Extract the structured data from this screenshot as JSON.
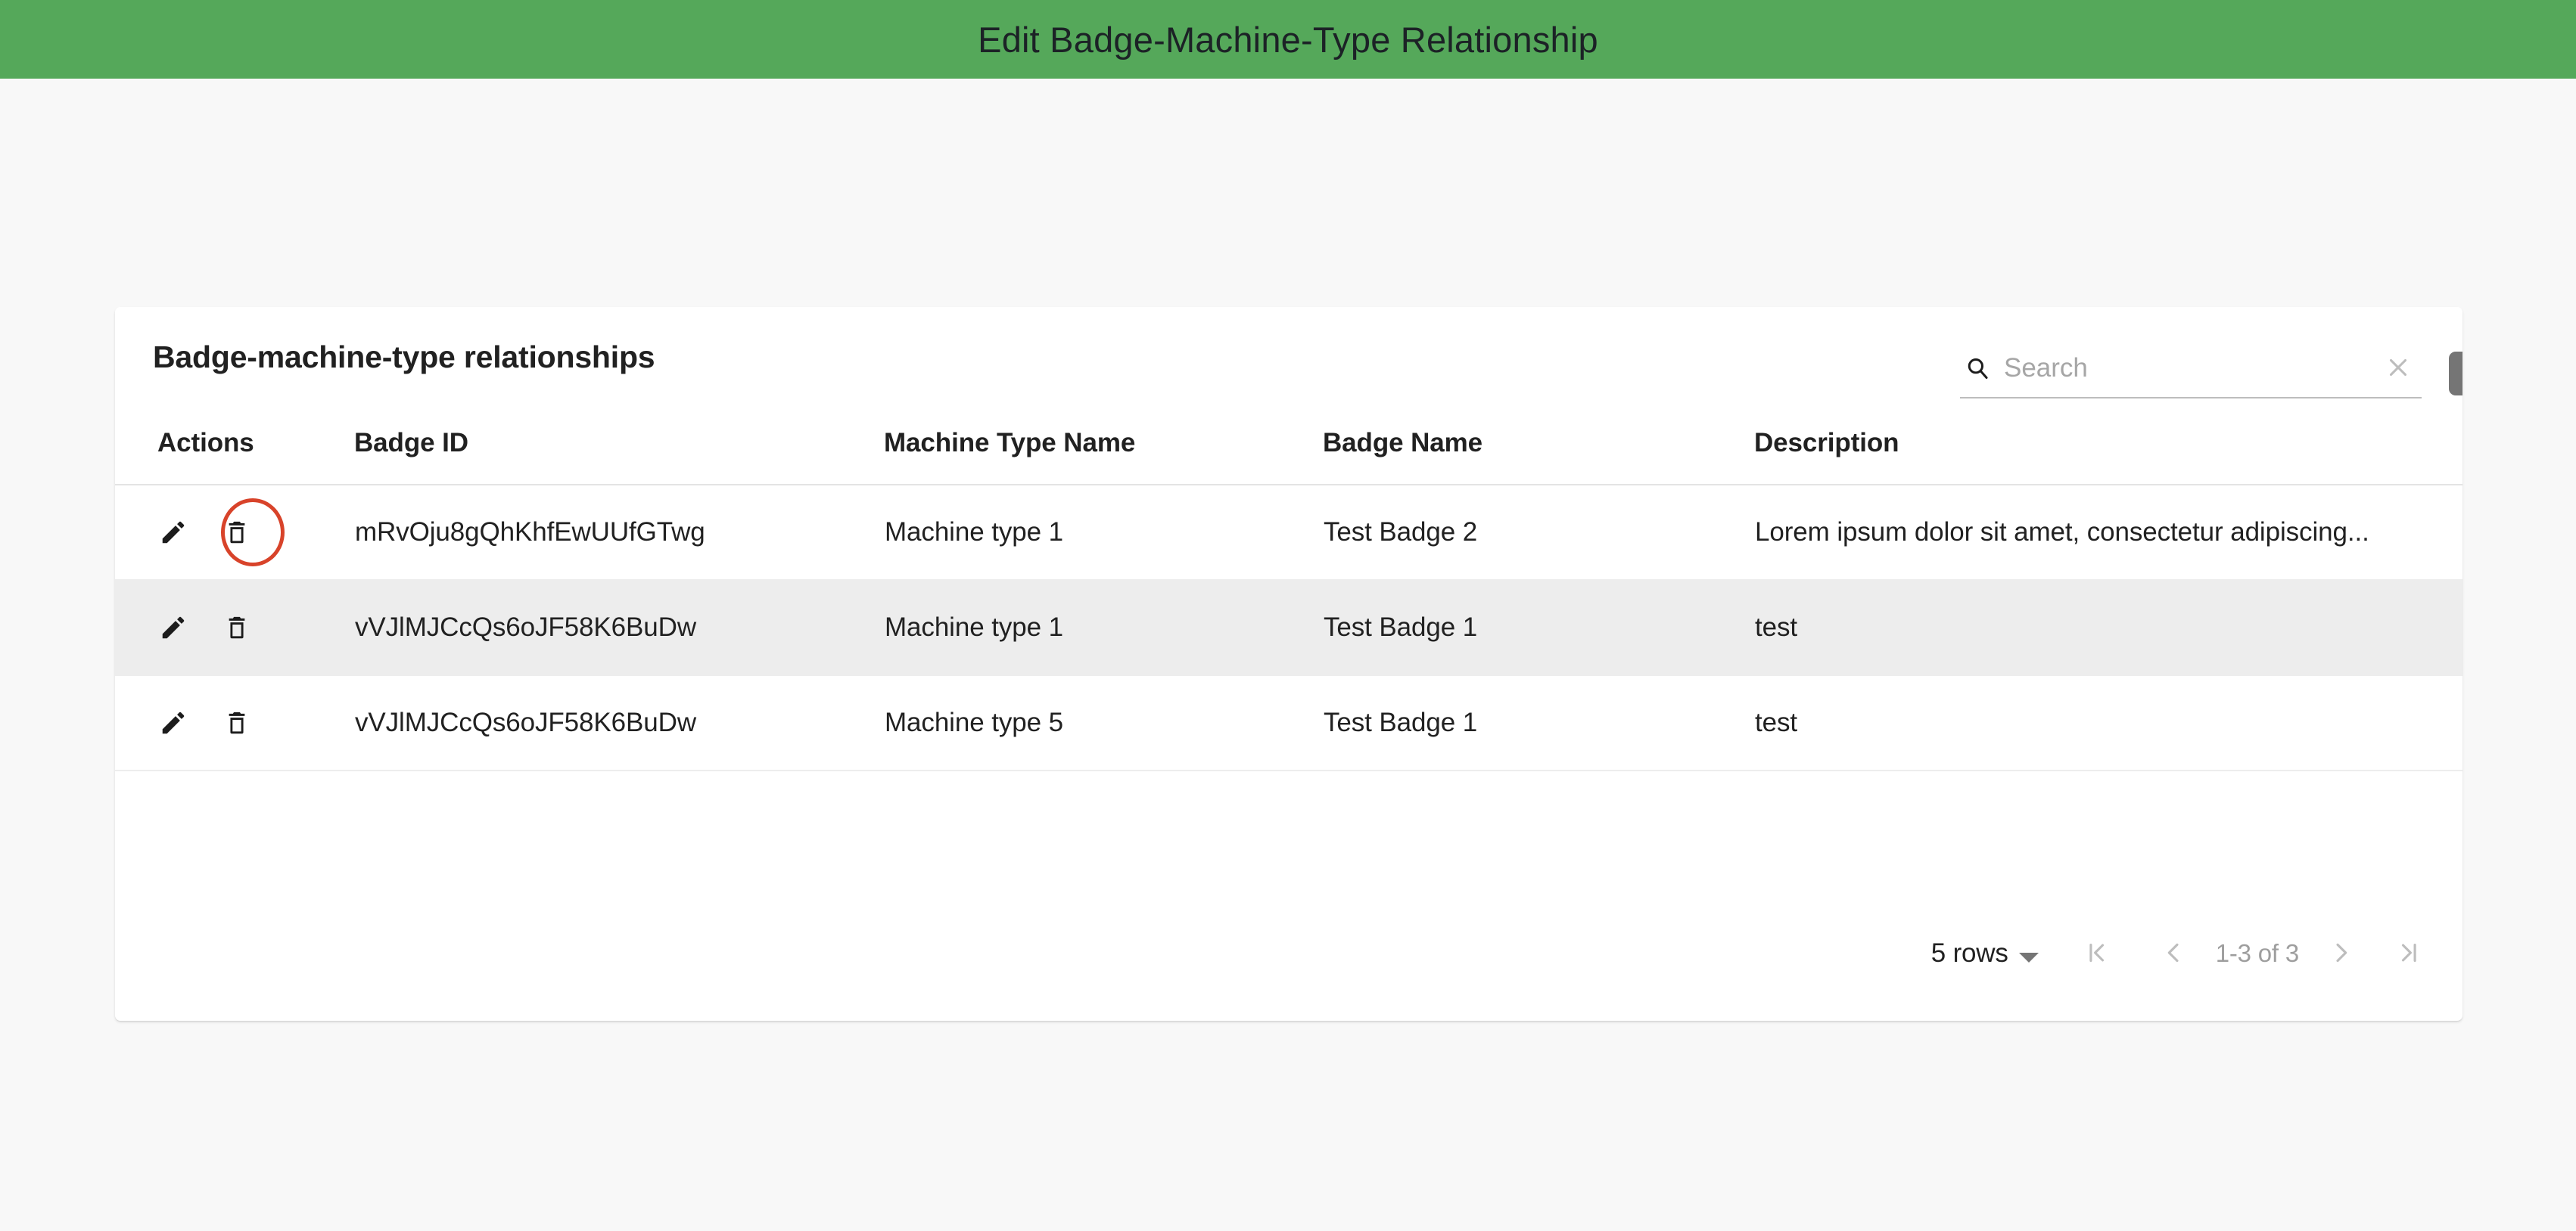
{
  "header": {
    "title": "Edit Badge-Machine-Type Relationship",
    "background_color": "#55a85a",
    "text_color": "#1c2226"
  },
  "card": {
    "title": "Badge-machine-type relationships",
    "search": {
      "value": "",
      "placeholder": "Search",
      "icon": "search-icon",
      "clear_icon": "close-icon"
    },
    "add_button": {
      "icon": "plus-icon",
      "label": "",
      "color": "#757575"
    },
    "table": {
      "columns": [
        "Actions",
        "Badge ID",
        "Machine Type Name",
        "Badge Name",
        "Description"
      ],
      "row_icons": {
        "edit": "pencil-icon",
        "delete": "trash-icon"
      },
      "rows": [
        {
          "badge_id": "mRvOju8gQhKhfEwUUfGTwg",
          "machine_type_name": "Machine type 1",
          "badge_name": "Test Badge 2",
          "description": "Lorem ipsum dolor sit amet, consectetur adipiscing...",
          "highlighted": false,
          "annotated_delete": true
        },
        {
          "badge_id": "vVJlMJCcQs6oJF58K6BuDw",
          "machine_type_name": "Machine type 1",
          "badge_name": "Test Badge 1",
          "description": "test",
          "highlighted": true,
          "annotated_delete": false
        },
        {
          "badge_id": "vVJlMJCcQs6oJF58K6BuDw",
          "machine_type_name": "Machine type 5",
          "badge_name": "Test Badge 1",
          "description": "test",
          "highlighted": false,
          "annotated_delete": false
        }
      ]
    },
    "paginator": {
      "rows_per_page_label": "5 rows",
      "range_label": "1-3 of 3",
      "first_icon": "first-page-icon",
      "prev_icon": "chevron-left-icon",
      "next_icon": "chevron-right-icon",
      "last_icon": "last-page-icon"
    }
  },
  "annotation": {
    "color": "#d8432a",
    "target": "delete-icon-row-1"
  }
}
